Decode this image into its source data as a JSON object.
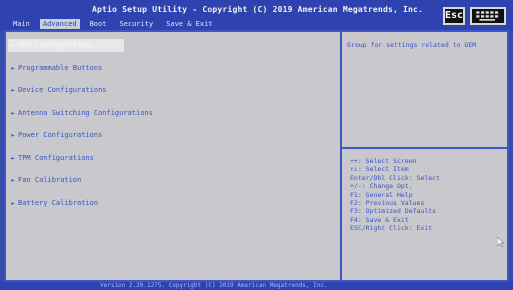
{
  "header": {
    "title": "Aptio Setup Utility - Copyright (C) 2019 American Megatrends, Inc.",
    "tabs": [
      "Main",
      "Advanced",
      "Boot",
      "Security",
      "Save & Exit"
    ],
    "active_tab": "Advanced",
    "esc_label": "Esc"
  },
  "menu": {
    "items": [
      "OEM Configurations",
      "Programmable Buttons",
      "Device Configurations",
      "Antenna Switching Configurations",
      "Power Configurations",
      "TPM Configurations",
      "Fan Calibration",
      "Battery Calibration"
    ]
  },
  "help": {
    "text": "Group for settings related to OEM"
  },
  "legend": {
    "lines": [
      "++: Select Screen",
      "↑↓: Select Item",
      "Enter/Dbl Click: Select",
      "+/-: Change Opt.",
      "F1: General Help",
      "F2: Previous Values",
      "F3: Optimized Defaults",
      "F4: Save & Exit",
      "ESC/Right Click: Exit"
    ]
  },
  "footer": {
    "text": "Version 2.20.1275. Copyright (C) 2019 American Megatrends, Inc."
  },
  "colors": {
    "blue_bar": "#2f43b0",
    "panel_gray": "#c9c9cd",
    "text_blue": "#3a53c6"
  }
}
